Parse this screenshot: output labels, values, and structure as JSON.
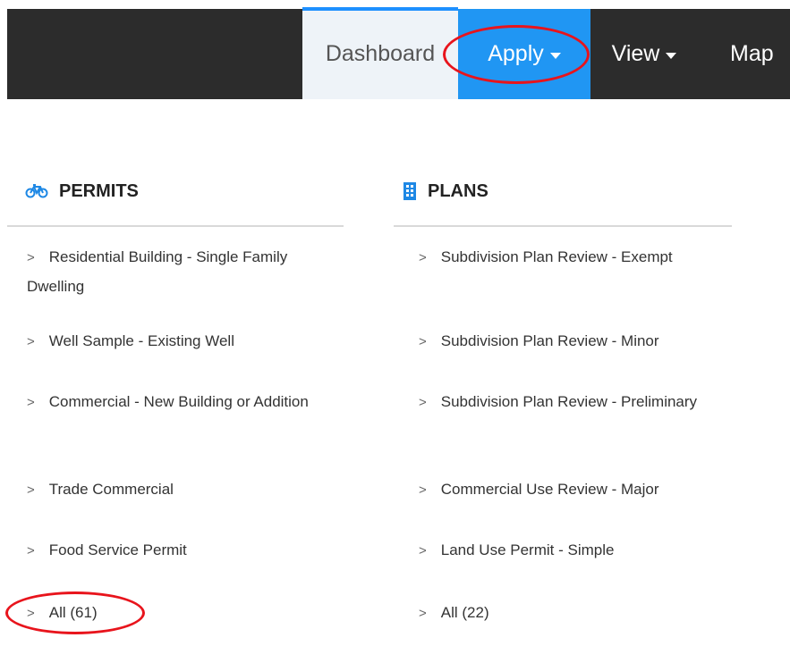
{
  "nav": {
    "dashboard": "Dashboard",
    "apply": "Apply",
    "view": "View",
    "map": "Map"
  },
  "permits": {
    "title": "PERMITS",
    "icon": "bicycle-icon",
    "items": [
      "Residential Building - Single Family Dwelling",
      "Well Sample - Existing Well",
      "Commercial - New Building or Addition",
      "Trade Commercial",
      "Food Service Permit",
      "All (61)"
    ]
  },
  "plans": {
    "title": "PLANS",
    "icon": "building-icon",
    "items": [
      "Subdivision Plan Review - Exempt",
      "Subdivision Plan Review - Minor",
      "Subdivision Plan Review - Preliminary",
      "Commercial Use Review - Major",
      "Land Use Permit - Simple",
      "All (22)"
    ]
  },
  "colors": {
    "nav_bg": "#2c2c2c",
    "apply_bg": "#2096f3",
    "dashboard_bg": "#eef3f8",
    "highlight": "#e8141c",
    "icon_blue": "#1e88e5"
  }
}
